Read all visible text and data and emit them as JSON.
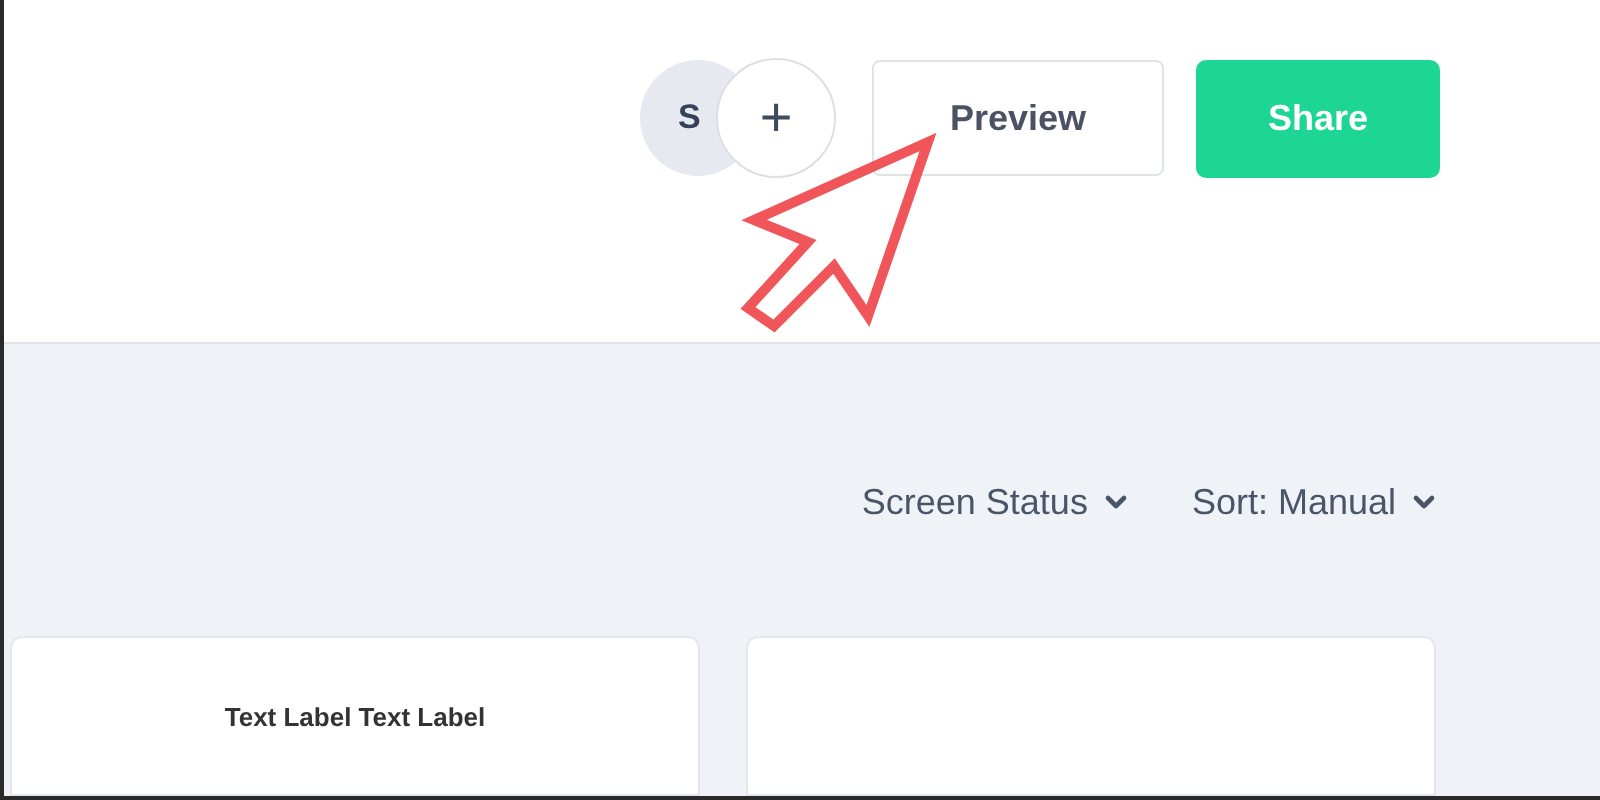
{
  "header": {
    "avatar": {
      "initials": "S"
    },
    "add_label": "+",
    "buttons": [
      {
        "label": "Preview",
        "kind": "outline"
      },
      {
        "label": "Share",
        "kind": "primary"
      }
    ]
  },
  "toolbar": {
    "filters": [
      {
        "label": "Screen Status"
      },
      {
        "label": "Sort: Manual"
      }
    ]
  },
  "cards": [
    {
      "kind": "labeled",
      "label": "Text Label Text Label"
    },
    {
      "kind": "blank"
    }
  ]
}
